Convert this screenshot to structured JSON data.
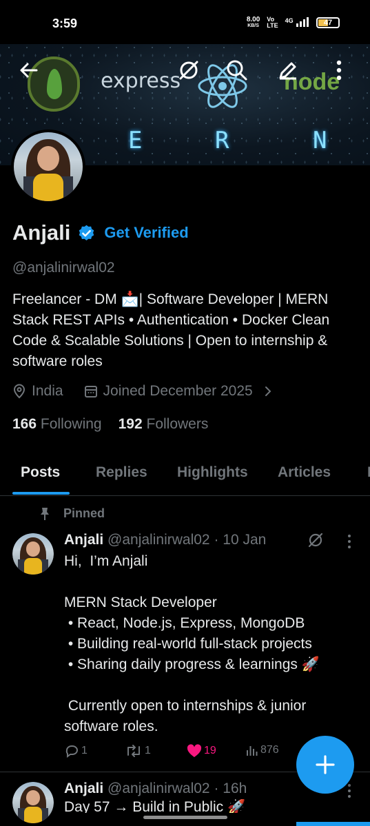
{
  "status_bar": {
    "time": "3:59",
    "net_speed_value": "8.00",
    "net_speed_unit": "KB/S",
    "volte_top": "Vo",
    "volte_bottom": "LTE",
    "network": "4G",
    "battery": "47"
  },
  "banner": {
    "express_text": "express",
    "node_text": "node",
    "mern_letters": [
      "E",
      "R",
      "N"
    ],
    "icons": [
      "back-arrow-icon",
      "grok-icon",
      "search-icon",
      "edit-icon",
      "more-vertical-icon"
    ]
  },
  "profile": {
    "name": "Anjali",
    "get_verified": "Get Verified",
    "handle": "@anjalinirwal02",
    "bio": "Freelancer - DM 📩| Software Developer | MERN Stack REST APIs • Authentication • Docker  Clean Code & Scalable Solutions | Open to internship & software roles",
    "location": "India",
    "joined": "Joined December 2025",
    "following_count": "166",
    "following_label": "Following",
    "followers_count": "192",
    "followers_label": "Followers"
  },
  "tabs": [
    {
      "label": "Posts",
      "active": true
    },
    {
      "label": "Replies",
      "active": false
    },
    {
      "label": "Highlights",
      "active": false
    },
    {
      "label": "Articles",
      "active": false
    },
    {
      "label": "M",
      "active": false
    }
  ],
  "pinned_label": "Pinned",
  "posts": [
    {
      "author": "Anjali",
      "handle": "@anjalinirwal02",
      "time": "· 10 Jan",
      "body": "Hi,  I’m Anjali\n\nMERN Stack Developer\n • React, Node.js, Express, MongoDB\n • Building real-world full-stack projects\n • Sharing daily progress & learnings 🚀\n\n Currently open to internships & junior software roles.",
      "replies": "1",
      "reposts": "1",
      "likes": "19",
      "views": "876"
    },
    {
      "author": "Anjali",
      "handle": "@anjalinirwal02",
      "time": "· 16h",
      "body": "Day 57 → Build in Public 🚀"
    }
  ],
  "colors": {
    "accent": "#1d9bf0",
    "like": "#f91880",
    "muted": "#71767b",
    "text": "#e7e9ea",
    "background": "#000000"
  }
}
